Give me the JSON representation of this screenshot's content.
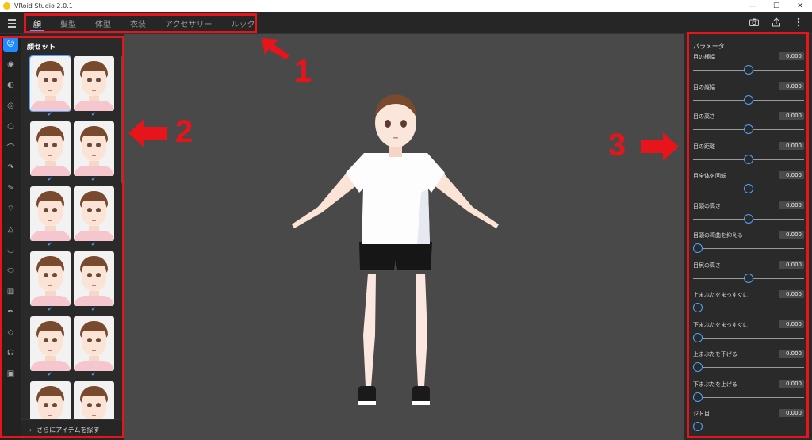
{
  "window": {
    "title": "VRoid Studio 2.0.1",
    "controls": [
      "—",
      "☐",
      "✕"
    ]
  },
  "tabs": [
    {
      "label": "顔",
      "active": true
    },
    {
      "label": "髪型",
      "active": false
    },
    {
      "label": "体型",
      "active": false
    },
    {
      "label": "衣装",
      "active": false
    },
    {
      "label": "アクセサリー",
      "active": false
    },
    {
      "label": "ルック",
      "active": false
    }
  ],
  "top_icons": [
    "camera-icon",
    "export-icon",
    "more-vert-icon"
  ],
  "rail_icons": [
    "face-icon",
    "eye-icon",
    "eyebrow-icon",
    "eyelash-icon",
    "eyeline-icon",
    "eyeline-upper-icon",
    "ear-icon",
    "brush-icon",
    "mouth-icon",
    "nose-icon",
    "lip-icon",
    "chin-icon",
    "teeth-icon",
    "pen-icon",
    "contour-icon",
    "ear-shape-icon",
    "accessory-icon"
  ],
  "face_panel": {
    "title": "顔セット",
    "count": 12,
    "selected_index": 0,
    "more_items_label": "さらにアイテムを探す"
  },
  "params": {
    "title": "パラメータ",
    "items": [
      {
        "label": "目の横幅",
        "value": "0.000",
        "level": 0.5
      },
      {
        "label": "目の縦幅",
        "value": "0.000",
        "level": 0.5
      },
      {
        "label": "目の高さ",
        "value": "0.000",
        "level": 0.5
      },
      {
        "label": "目の距離",
        "value": "0.000",
        "level": 0.5
      },
      {
        "label": "目全体を回転",
        "value": "0.000",
        "level": 0.5
      },
      {
        "label": "目頭の高さ",
        "value": "0.000",
        "level": 0.5
      },
      {
        "label": "目頭の湾曲を抑える",
        "value": "0.000",
        "level": 0.0
      },
      {
        "label": "目尻の高さ",
        "value": "0.000",
        "level": 0.5
      },
      {
        "label": "上まぶたをまっすぐに",
        "value": "0.000",
        "level": 0.0
      },
      {
        "label": "下まぶたをまっすぐに",
        "value": "0.000",
        "level": 0.0
      },
      {
        "label": "上まぶたを下げる",
        "value": "0.000",
        "level": 0.0
      },
      {
        "label": "下まぶたを上げる",
        "value": "0.000",
        "level": 0.0
      },
      {
        "label": "ジト目",
        "value": "0.000",
        "level": 0.0
      }
    ]
  },
  "annotations": [
    "1",
    "2",
    "3"
  ],
  "colors": {
    "accent": "#1e8cff",
    "annotation": "#e8141b",
    "viewport": "#494949"
  }
}
